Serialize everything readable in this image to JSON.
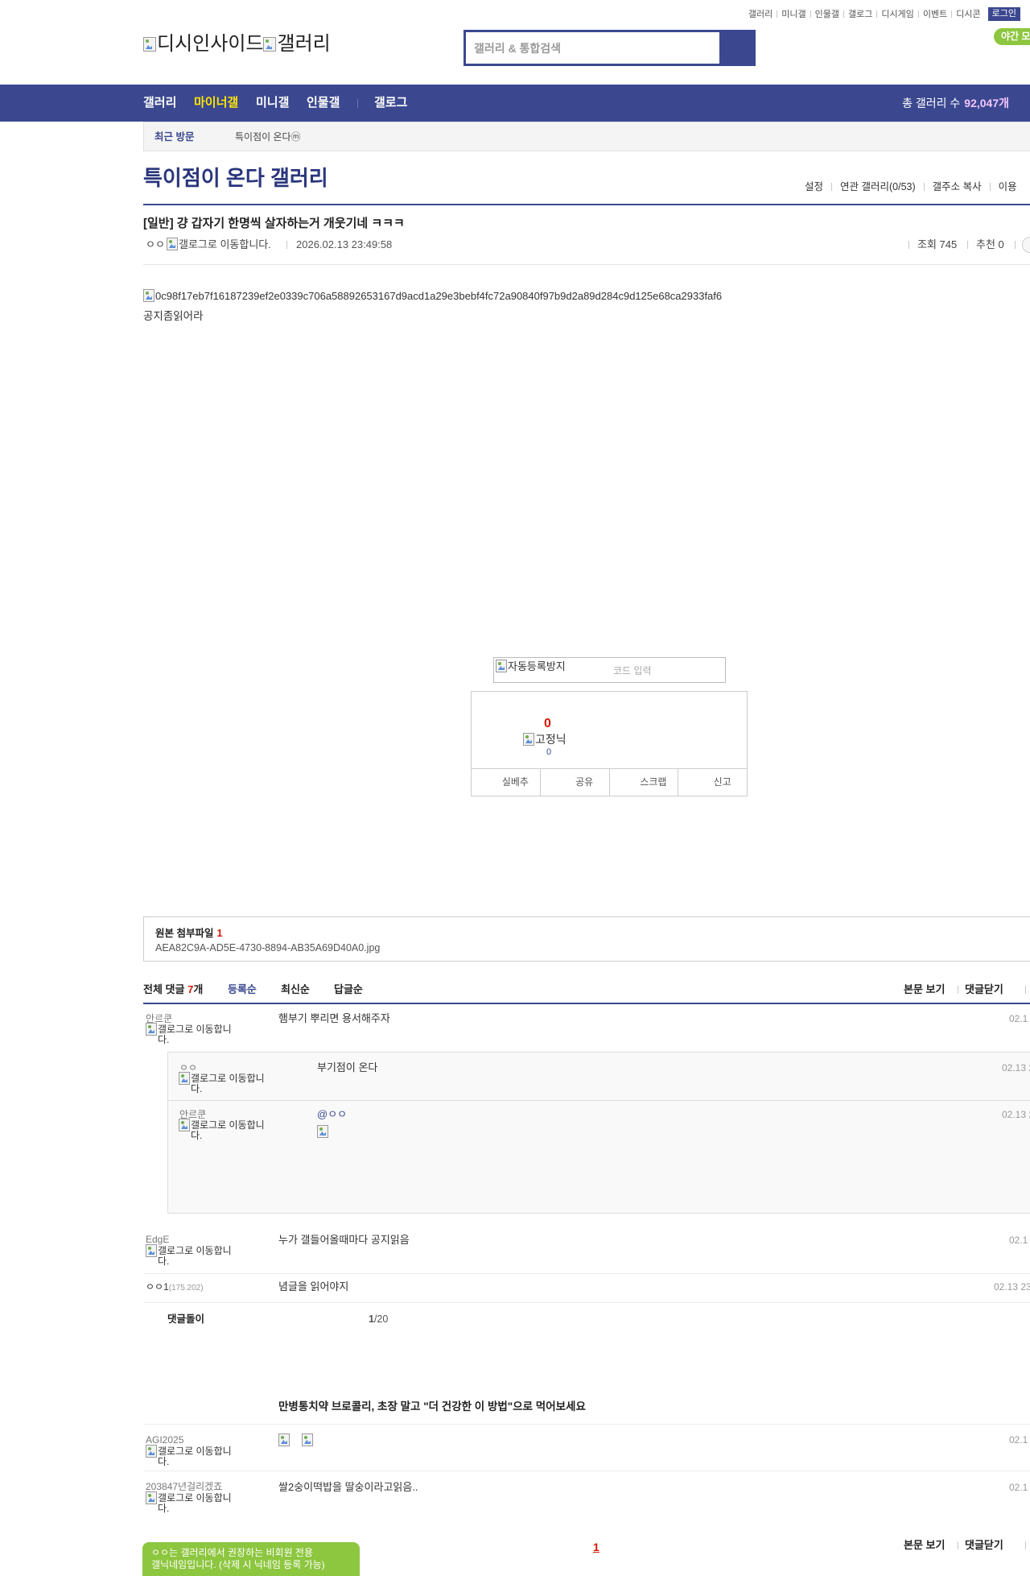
{
  "top_links": [
    "갤러리",
    "미니갤",
    "인물갤",
    "갤로그",
    "디시게임",
    "이벤트",
    "디시콘"
  ],
  "login_label": "로그인",
  "night_mode_label": "야간 모",
  "logo": {
    "site_alt": "디시인사이드",
    "gallery_alt": "갤러리"
  },
  "search": {
    "placeholder": "갤러리 & 통합검색"
  },
  "nav": {
    "items": [
      "갤러리",
      "마이너갤",
      "미니갤",
      "인물갤",
      "갤로그"
    ],
    "total_label": "총 갤러리 수",
    "total_count": "92,047개"
  },
  "recent_visits": {
    "label": "최근 방문",
    "items": [
      "특이점이 온다ⓜ"
    ]
  },
  "gallery": {
    "title": "특이점이 온다 갤러리",
    "links": [
      "설정",
      "연관 갤러리(0/53)",
      "갤주소 복사",
      "이용"
    ]
  },
  "post": {
    "title": "[일반] 걍 갑자기 한명씩 살자하는거 개웃기네 ㅋㅋㅋ",
    "author": "ㅇㅇ",
    "gallog_alt": "갤로그로 이동합니다.",
    "date": "2026.02.13 23:49:58",
    "views": "조회 745",
    "recommends": "추천 0",
    "image_alt": "0c98f17eb7f16187239ef2e0339c706a58892653167d9acd1a29e3bebf4fc72a90840f97b9d2a89d284c9d125e68ca2933faf6",
    "body": "공지좀읽어라"
  },
  "captcha": {
    "image_alt": "자동등록방지",
    "placeholder": "코드 입력"
  },
  "recommend": {
    "count": "0",
    "fixed_nick_alt": "고정닉",
    "fixed_nick_count": "0",
    "buttons": [
      "실베추",
      "공유",
      "스크랩",
      "신고"
    ]
  },
  "attachment": {
    "label": "원본 첨부파일",
    "count": "1",
    "filename": "AEA82C9A-AD5E-4730-8894-AB35A69D40A0.jpg"
  },
  "comments": {
    "header": {
      "label": "전체 댓글",
      "count": "7",
      "unit": "개"
    },
    "sort": [
      "등록순",
      "최신순",
      "답글순"
    ],
    "actions": [
      "본문 보기",
      "댓글닫기"
    ],
    "items": [
      {
        "nick": "안르쿤",
        "gallog_alt": "갤로그로 이동합니다.",
        "text": "햄부기 뿌리면 용서해주자",
        "date": "02.1",
        "replies": [
          {
            "nick": "ㅇㅇ",
            "gallog_alt": "갤로그로 이동합니다.",
            "text": "부기점이 온다",
            "date": "02.13 2"
          },
          {
            "nick": "안르쿤",
            "gallog_alt": "갤로그로 이동합니다.",
            "mention": "@ㅇㅇ",
            "date": "02.13 2"
          }
        ]
      },
      {
        "nick": "EdgE",
        "gallog_alt": "갤로그로 이동합니다.",
        "text": "누가 갤들어올때마다 공지읽음",
        "date": "02.1"
      },
      {
        "nick": "ㅇㅇ1",
        "ip": "(175.202)",
        "text": "념글을 읽어야지",
        "date": "02.13 23"
      },
      {
        "nick": "AGI2025",
        "gallog_alt": "갤로그로 이동합니다.",
        "date": "02.1"
      },
      {
        "nick": "203847년걸리겠죠",
        "gallog_alt": "갤로그로 이동합니다.",
        "text": "쌀2숭이떡밥을 딸숭이라고읽음..",
        "date": "02.1"
      }
    ],
    "bot": {
      "name": "댓글돌이",
      "page_current": "1",
      "page_suffix": "/20"
    },
    "ad_title": "만병통치약 브로콜리, 초장 말고 \"더 건강한 이 방법\"으로 먹어보세요"
  },
  "footer": {
    "notice_line1": "ㅇㅇ는 갤러리에서 권장하는 비회원 전용",
    "notice_line2": "갤닉네임입니다. (삭제 시 닉네임 등록 가능)",
    "pagination": [
      "1"
    ]
  },
  "colors": {
    "brand_blue": "#3b4890",
    "title_blue": "#29367c",
    "minor_yellow": "#ffe600",
    "count_red": "#d31900",
    "notice_green": "#8dc63f"
  },
  "icons": [
    "broken-image-icon",
    "search-button"
  ]
}
